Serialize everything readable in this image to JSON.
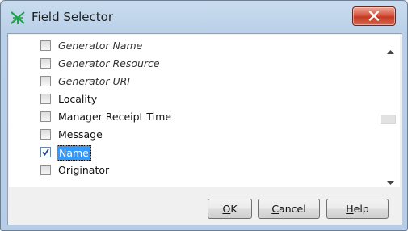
{
  "window": {
    "title": "Field Selector"
  },
  "fields": [
    {
      "label": "Generator Name",
      "italic": true,
      "checked": false,
      "selected": false
    },
    {
      "label": "Generator Resource",
      "italic": true,
      "checked": false,
      "selected": false
    },
    {
      "label": "Generator URI",
      "italic": true,
      "checked": false,
      "selected": false
    },
    {
      "label": "Locality",
      "italic": false,
      "checked": false,
      "selected": false
    },
    {
      "label": "Manager Receipt Time",
      "italic": false,
      "checked": false,
      "selected": false
    },
    {
      "label": "Message",
      "italic": false,
      "checked": false,
      "selected": false
    },
    {
      "label": "Name",
      "italic": false,
      "checked": true,
      "selected": true
    },
    {
      "label": "Originator",
      "italic": false,
      "checked": false,
      "selected": false
    }
  ],
  "buttons": {
    "ok": {
      "mnemonic": "O",
      "rest": "K"
    },
    "cancel": {
      "mnemonic": "C",
      "rest": "ancel"
    },
    "help": {
      "mnemonic": "H",
      "rest": "elp"
    }
  },
  "icons": {
    "app": "field-selector-icon",
    "close": "close-icon",
    "scroll_up": "scroll-up-arrow-icon",
    "scroll_down": "scroll-down-arrow-icon",
    "check": "checkmark-icon"
  },
  "colors": {
    "selection": "#3399ff",
    "close_button": "#c94a33",
    "app_icon": "#1ea34a"
  }
}
